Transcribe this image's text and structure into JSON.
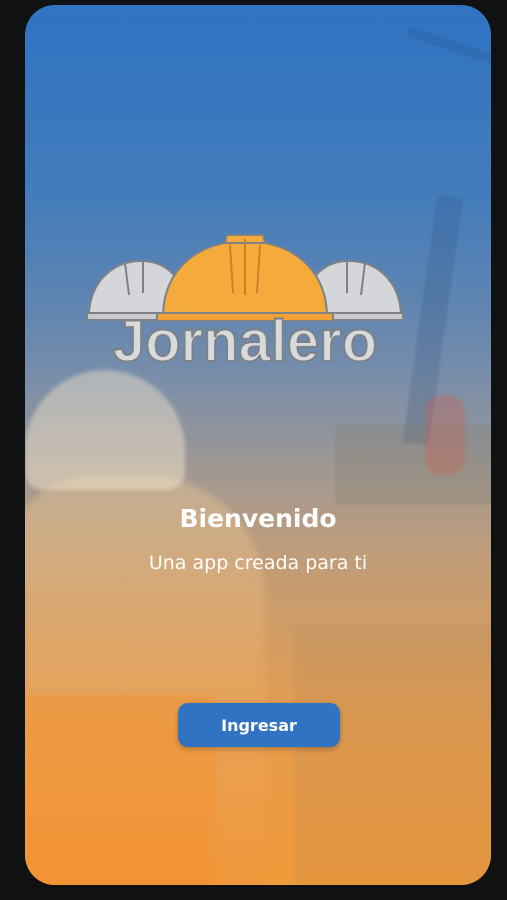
{
  "app": {
    "logo_text": "Jornalero"
  },
  "welcome": {
    "title": "Bienvenido",
    "subtitle": "Una app creada para ti"
  },
  "actions": {
    "enter_label": "Ingresar"
  },
  "icons": {
    "logo": "hard-hats-icon"
  },
  "colors": {
    "gradient_top": "#2f73c2",
    "gradient_bottom": "#f19a3a",
    "button": "#2f73c2",
    "center_helmet": "#f5ab3c",
    "side_helmets": "#d4d6d9"
  }
}
